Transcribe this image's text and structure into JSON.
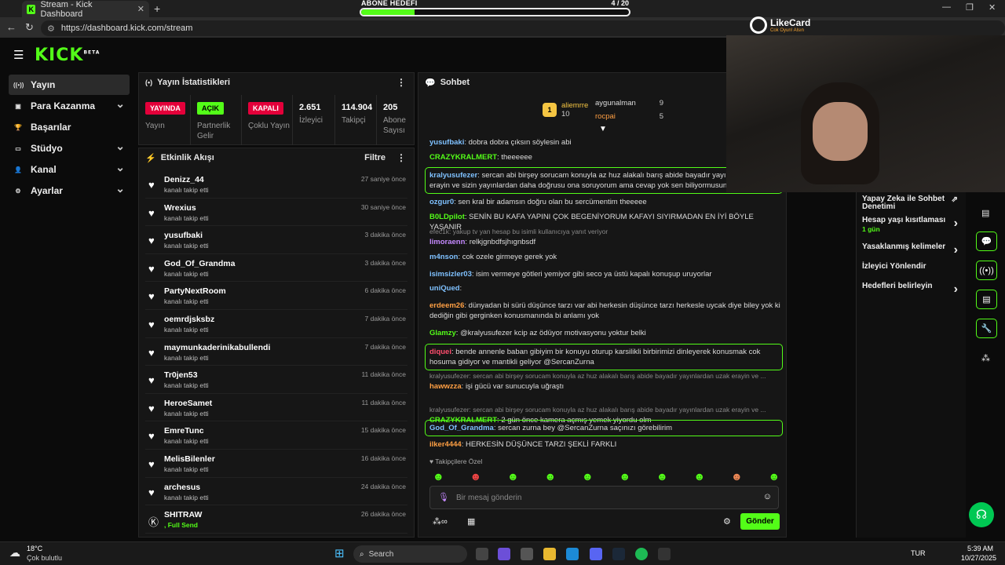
{
  "browser": {
    "tab_title": "Stream - Kick Dashboard",
    "url": "https://dashboard.kick.com/stream"
  },
  "goal": {
    "label": "ABONE HEDEFİ",
    "count": "4",
    "total": "/ 20",
    "progress": 0.2
  },
  "likecard": {
    "name": "LikeCard",
    "tagline": "Cok Oyun! Alsın"
  },
  "logo": {
    "text": "KICK",
    "beta": "BETA"
  },
  "sidebar": {
    "items": [
      {
        "label": "Yayın",
        "icon": "broadcast-icon",
        "active": true,
        "chev": false
      },
      {
        "label": "Para Kazanma",
        "icon": "money-icon",
        "chev": true
      },
      {
        "label": "Başarılar",
        "icon": "trophy-icon",
        "chev": false
      },
      {
        "label": "Stüdyo",
        "icon": "studio-icon",
        "chev": true
      },
      {
        "label": "Kanal",
        "icon": "channel-icon",
        "chev": true
      },
      {
        "label": "Ayarlar",
        "icon": "gear-icon",
        "chev": true
      }
    ]
  },
  "stats": {
    "title": "Yayın İstatistikleri",
    "cells": [
      {
        "badge": "YAYINDA",
        "label": "Yayın"
      },
      {
        "badge": "AÇIK",
        "label": "Partnerlik Gelir"
      },
      {
        "badge": "KAPALI",
        "label": "Çoklu Yayın"
      },
      {
        "value": "2.651",
        "label": "İzleyici"
      },
      {
        "value": "114.904",
        "label": "Takipçi"
      },
      {
        "value": "205",
        "label": "Abone Sayısı"
      }
    ]
  },
  "activity": {
    "title": "Etkinlik Akışı",
    "filter": "Filtre",
    "items": [
      {
        "name": "Denizz_44",
        "sub": "kanalı takip etti",
        "time": "27 saniye önce"
      },
      {
        "name": "Wrexius",
        "sub": "kanalı takip etti",
        "time": "30 saniye önce"
      },
      {
        "name": "yusufbaki",
        "sub": "kanalı takip etti",
        "time": "3 dakika önce"
      },
      {
        "name": "God_Of_Grandma",
        "sub": "kanalı takip etti",
        "time": "3 dakika önce"
      },
      {
        "name": "PartyNextRoom",
        "sub": "kanalı takip etti",
        "time": "6 dakika önce"
      },
      {
        "name": "oemrdjsksbz",
        "sub": "kanalı takip etti",
        "time": "7 dakika önce"
      },
      {
        "name": "maymunkaderinikabullendi",
        "sub": "kanalı takip etti",
        "time": "7 dakika önce"
      },
      {
        "name": "Tr0jen53",
        "sub": "kanalı takip etti",
        "time": "11 dakika önce"
      },
      {
        "name": "HeroeSamet",
        "sub": "kanalı takip etti",
        "time": "11 dakika önce"
      },
      {
        "name": "EmreTunc",
        "sub": "kanalı takip etti",
        "time": "15 dakika önce"
      },
      {
        "name": "MelisBilenler",
        "sub": "kanalı takip etti",
        "time": "16 dakika önce"
      },
      {
        "name": "archesus",
        "sub": "kanalı takip etti",
        "time": "24 dakika önce"
      },
      {
        "name": "SHITRAW",
        "sub": ", Full Send",
        "time": "26 dakika önce"
      }
    ]
  },
  "chat": {
    "title": "Sohbet",
    "leaders": [
      {
        "name": "aliemrre",
        "count": "10"
      },
      {
        "name": "aygunalman",
        "count": "9"
      },
      {
        "name": "rocpai",
        "count": "5"
      }
    ],
    "messages": [
      {
        "user": "yusufbaki",
        "color": "#7fc1ff",
        "text": "dobra dobra çıksın söylesin abi"
      },
      {
        "user": "CRAZYKRALMERT",
        "color": "#53fc18",
        "text": "theeeeee"
      },
      {
        "user": "kralyusufezer",
        "color": "#7fc1ff",
        "text": "sercan abi birşey sorucam konuyla az huz alakalı barış abide bayadır yayınlardan uzak erayin ve sizin yayınlardan daha doğrusu ona soruyorum ama cevap yok sen biliyormusun?@",
        "hl": true
      },
      {
        "user": "ozgur0",
        "color": "#7fc1ff",
        "text": "sen kral bir adamsın doğru olan bu sercümentim theeeee"
      },
      {
        "user": "B0LDpilot",
        "color": "#53fc18",
        "text": "SENİN BU KAFA YAPINI ÇOK BEGENİYORUM KAFAYI SIYIRMADAN EN İYİ BÖYLE YAŞANIR"
      },
      {
        "reply": "efec1k: yakup tv yan hesap bu isimli kullanıcıya yanıt veriyor",
        "user": "limoraenn",
        "color": "#c589ff",
        "text": "relkjgnbdfsjhıgnbsdf"
      },
      {
        "user": "m4nson",
        "color": "#7fc1ff",
        "text": "cok ozele girmeye gerek yok"
      },
      {
        "user": "isimsizler03",
        "color": "#7fc1ff",
        "text": "isim vermeye götleri yemiyor gibi seco ya üstü kapalı konuşup uruyorlar"
      },
      {
        "user": "uniQued",
        "color": "#7fc1ff",
        "text": ""
      },
      {
        "user": "erdeem26",
        "color": "#ff9f43",
        "text": "dünyadan bi sürü düşünce tarzı var abi herkesin düşünce tarzı herkesle uycak diye biley yok ki dediğin gibi gerginken konusmanında bi anlamı yok"
      },
      {
        "user": "Glamzy",
        "color": "#53fc18",
        "text": "@kralyusufezer kcip az ödüyor motivasyonu yoktur belki"
      },
      {
        "user": "diquei",
        "color": "#ff4d6d",
        "text": "bende annenle baban gibiyim bir konuyu oturup karsilikli birbirimizi dinleyerek konusmak cok hosuma gidiyor ve mantikli geliyor @SercanZurna",
        "hl": true
      },
      {
        "reply": "kralyusufezer: sercan abi birşey sorucam konuyla az huz alakalı barış abide bayadır yayınlardan uzak erayin ve ...",
        "user": "hawwzza",
        "color": "#ff9f43",
        "text": "işi gücü var sunucuyla uğraştı"
      },
      {
        "reply": "kralyusufezer: sercan abi birşey sorucam konuyla az huz alakalı barış abide bayadır yayınlardan uzak erayin ve ...",
        "user": "CRAZYKRALMERT",
        "color": "#53fc18",
        "text": "2 gün önce kamera açmış yemek yiyordu olm"
      },
      {
        "user": "God_Of_Grandma",
        "color": "#7fc1ff",
        "text": "sercan zurna bey @SercanZurna saçınızı görebilirim",
        "hl": true
      },
      {
        "user": "ilker4444",
        "color": "#ff9f43",
        "text": "HERKESİN DÜŞÜNCE TARZI ŞEKLİ FARKLI"
      }
    ],
    "followers_only": "Takipçilere Özel",
    "input_placeholder": "Bir mesaj gönderin",
    "send": "Gönder"
  },
  "rightpanel": {
    "items": [
      {
        "label": "Yapay Zeka ile Sohbet Denetimi"
      },
      {
        "label": "Hesap yaşı kısıtlaması",
        "sub": "1 gün"
      },
      {
        "label": "Yasaklanmış kelimeler"
      },
      {
        "label": "İzleyici Yönlendir"
      },
      {
        "label": "Hedefleri belirleyin"
      }
    ]
  },
  "taskbar": {
    "weather_temp": "18°C",
    "weather_desc": "Çok bulutlu",
    "search": "Search",
    "lang": "TUR",
    "time": "5:39 AM",
    "date": "10/27/2025"
  },
  "colors": {
    "accent": "#53fc18",
    "live": "#e4003a"
  }
}
